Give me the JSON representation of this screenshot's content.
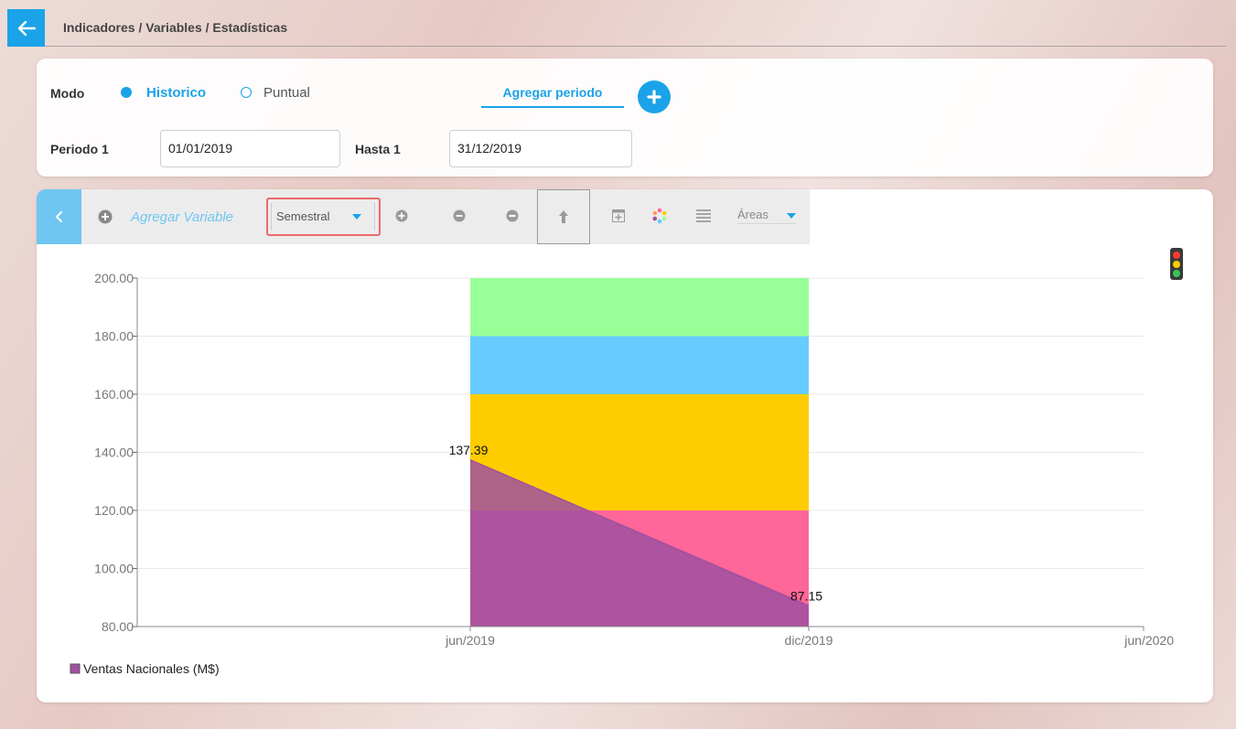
{
  "header": {
    "breadcrumb": "Indicadores / Variables / Estadísticas"
  },
  "filters": {
    "mode_label": "Modo",
    "mode_options": [
      {
        "label": "Historico",
        "selected": true
      },
      {
        "label": "Puntual",
        "selected": false
      }
    ],
    "add_period_label": "Agregar periodo",
    "period_label": "Periodo 1",
    "period_value": "01/01/2019",
    "until_label": "Hasta 1",
    "until_value": "31/12/2019"
  },
  "toolbar": {
    "add_variable_label": "Agregar Variable",
    "frequency_selected": "Semestral",
    "chart_type_selected": "Áreas"
  },
  "colors": {
    "accent": "#1aa3e8",
    "toolbar_accent": "#6fc6f1",
    "highlight_border": "#ec6a6a"
  },
  "chart_data": {
    "type": "area",
    "xlim": [
      "jun/2019",
      "jun/2020"
    ],
    "x_ticks": [
      "jun/2019",
      "dic/2019",
      "jun/2020"
    ],
    "ylim": [
      80,
      200
    ],
    "y_ticks": [
      "80.00",
      "100.00",
      "120.00",
      "140.00",
      "160.00",
      "180.00",
      "200.00"
    ],
    "grid": true,
    "legend_position": "bottom-left",
    "bands": [
      {
        "from": 80,
        "to": 120,
        "color": "#ff6699"
      },
      {
        "from": 120,
        "to": 160,
        "color": "#ffcc00"
      },
      {
        "from": 160,
        "to": 180,
        "color": "#66ccff"
      },
      {
        "from": 180,
        "to": 200,
        "color": "#99ff99"
      }
    ],
    "series": [
      {
        "name": "Ventas Nacionales (M$)",
        "color": "#a050a0",
        "x": [
          "jun/2019",
          "dic/2019"
        ],
        "values": [
          137.39,
          87.15
        ],
        "labels": [
          "137.39",
          "87.15"
        ]
      }
    ]
  }
}
